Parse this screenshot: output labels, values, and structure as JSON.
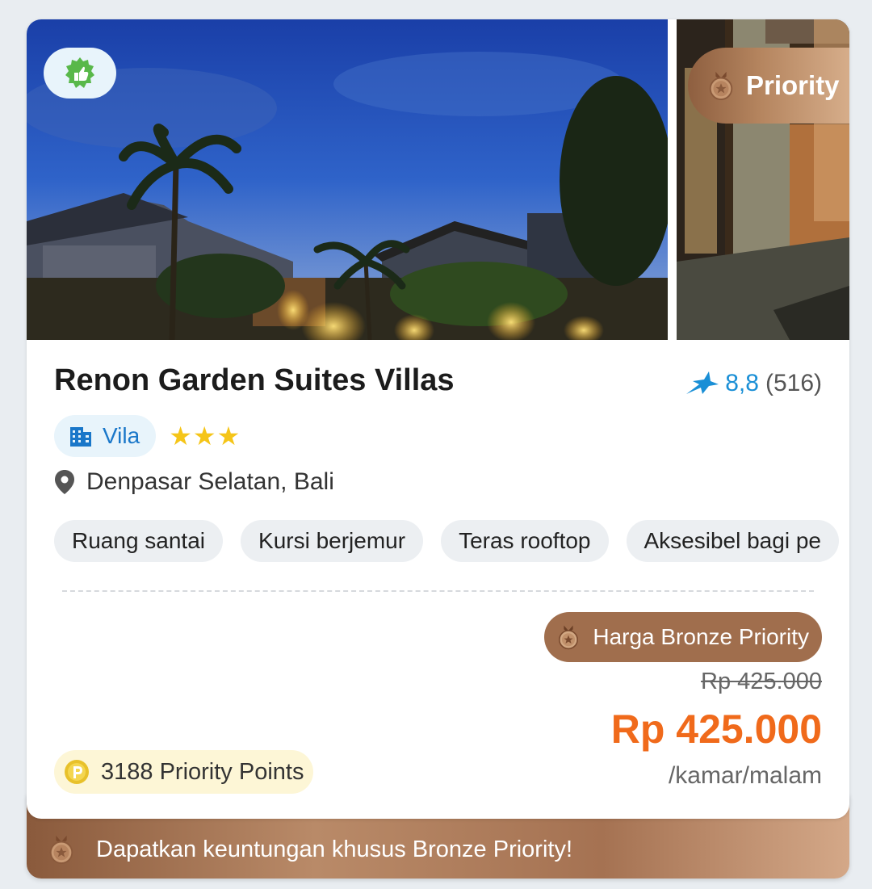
{
  "listing": {
    "name": "Renon Garden Suites Villas",
    "rating_score": "8,8",
    "rating_count": "(516)",
    "type_label": "Vila",
    "stars": "★★★",
    "location": "Denpasar Selatan, Bali",
    "priority_ribbon": "Priority",
    "amenities": [
      "Ruang santai",
      "Kursi berjemur",
      "Teras rooftop",
      "Aksesibel bagi pe"
    ]
  },
  "pricing": {
    "badge_label": "Harga Bronze Priority",
    "original_price": "Rp 425.000",
    "final_price": "Rp 425.000",
    "unit": "/kamar/malam",
    "points": "3188 Priority Points"
  },
  "promo": {
    "text": "Dapatkan keuntungan khusus Bronze Priority!"
  },
  "colors": {
    "price": "#f06a1b",
    "rating": "#1a8fd6",
    "bronze": "#a06e4d",
    "star": "#f5c518"
  }
}
